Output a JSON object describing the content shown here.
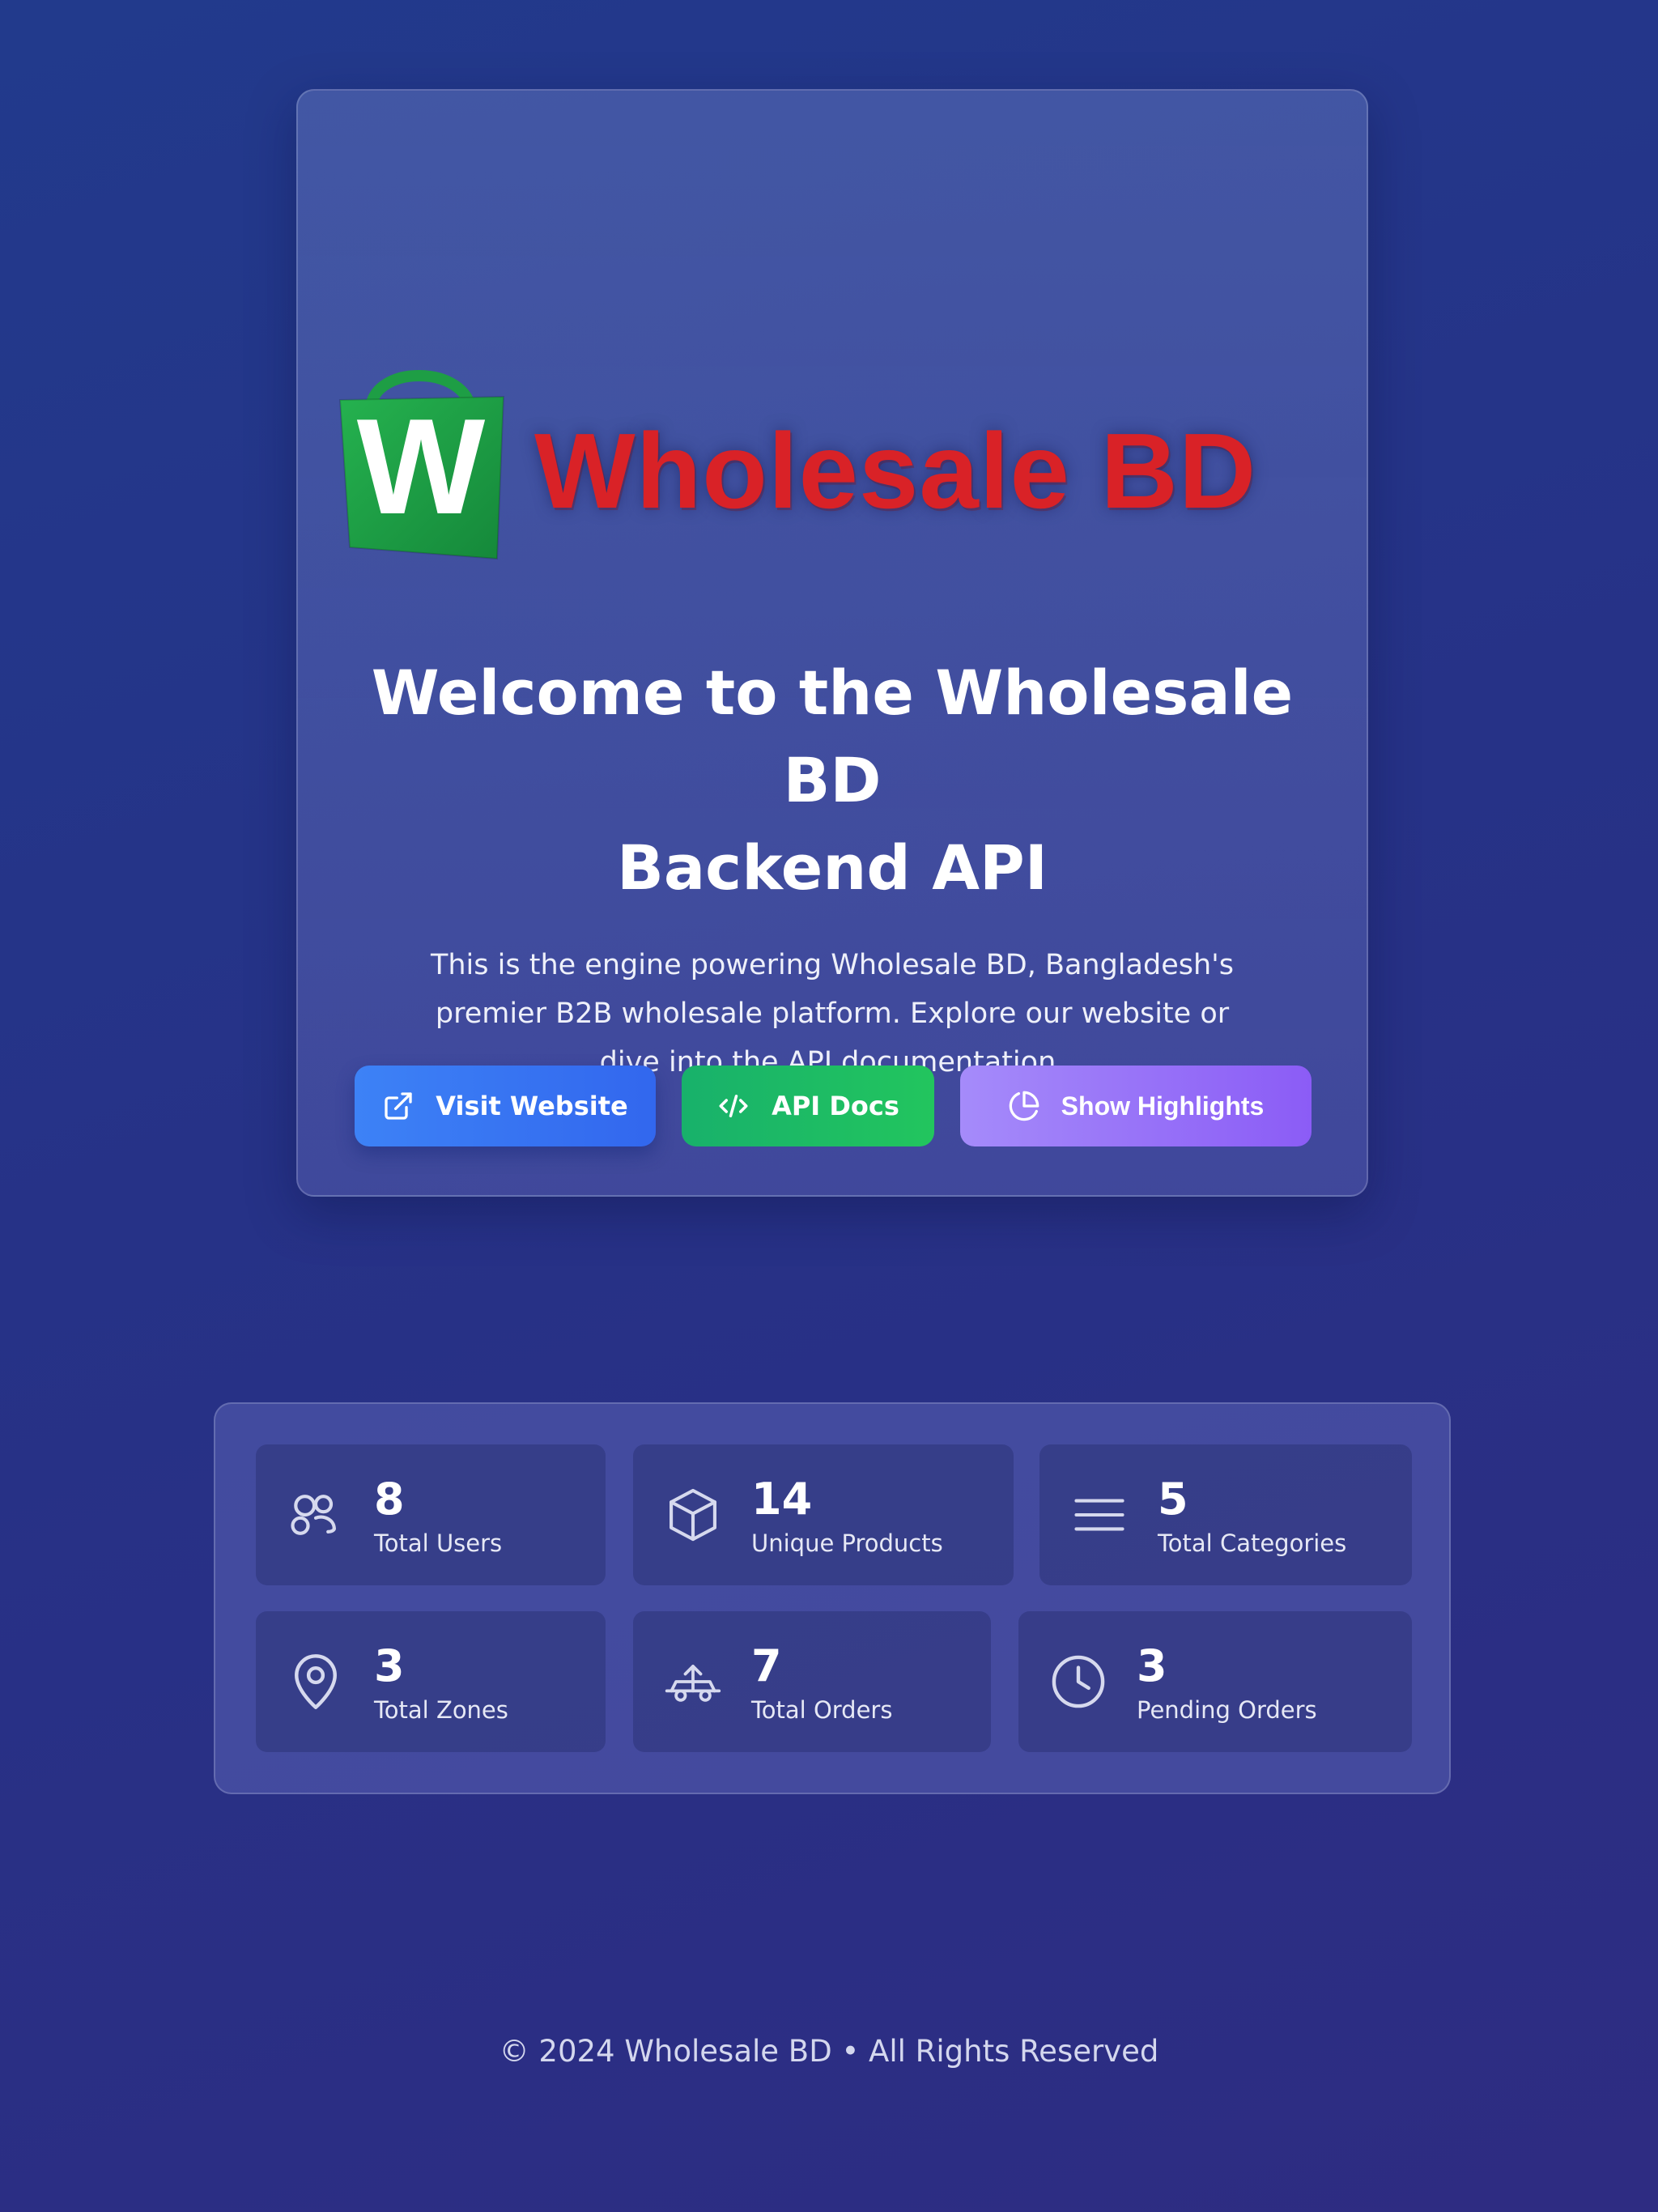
{
  "logo": {
    "letter": "W",
    "text": "Wholesale BD"
  },
  "hero": {
    "title_line1": "Welcome to the Wholesale BD",
    "title_line2": "Backend API",
    "description": "This is the engine powering Wholesale BD, Bangladesh's premier B2B wholesale platform. Explore our website or dive into the API documentation."
  },
  "buttons": {
    "visit": {
      "label": "Visit Website",
      "icon": "external-link-icon",
      "color": "#3b82f6"
    },
    "docs": {
      "label": "API Docs",
      "icon": "code-icon",
      "color": "#22c55e"
    },
    "highlights": {
      "label": "Show Highlights",
      "icon": "pie-chart-icon",
      "color": "#8b5cf6"
    }
  },
  "stats": [
    {
      "value": "8",
      "label": "Total Users",
      "icon": "users-icon"
    },
    {
      "value": "14",
      "label": "Unique Products",
      "icon": "box-icon"
    },
    {
      "value": "5",
      "label": "Total Categories",
      "icon": "list-icon"
    },
    {
      "value": "3",
      "label": "Total Zones",
      "icon": "map-pin-icon"
    },
    {
      "value": "7",
      "label": "Total Orders",
      "icon": "truck-icon"
    },
    {
      "value": "3",
      "label": "Pending Orders",
      "icon": "clock-icon"
    }
  ],
  "footer": {
    "text": "© 2024 Wholesale BD • All Rights Reserved"
  },
  "colors": {
    "background": "#25348a",
    "logo_bag": "#1fa84a",
    "logo_text": "#d92227"
  }
}
